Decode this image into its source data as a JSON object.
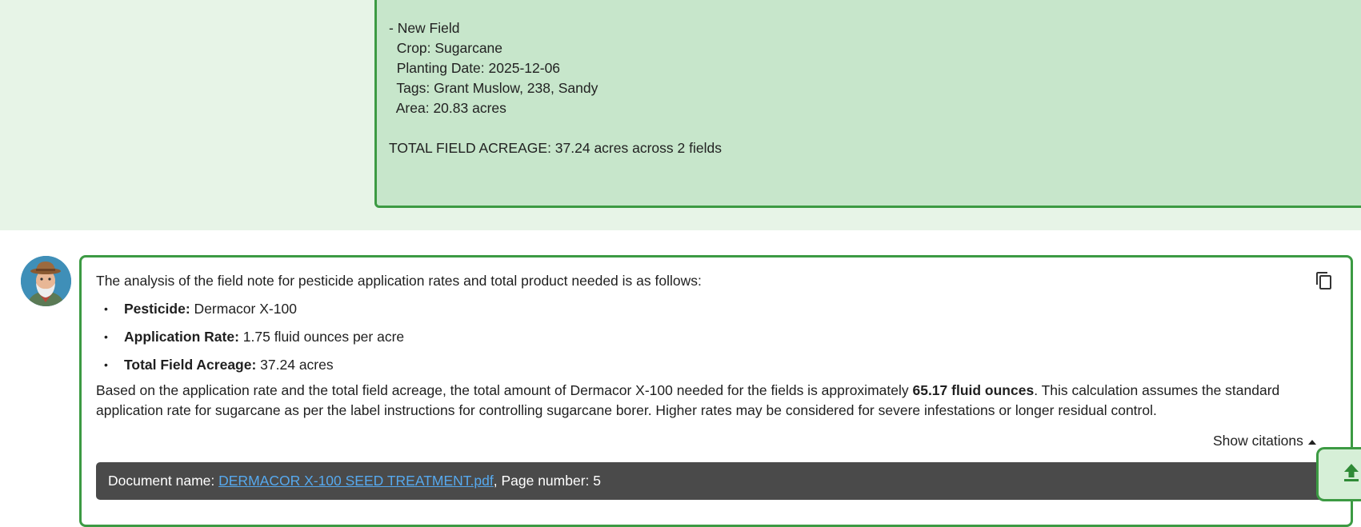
{
  "user_message": {
    "lines": [
      "- New Field",
      "  Crop: Sugarcane",
      "  Planting Date: 2025-12-06",
      "  Tags: Grant Muslow, 238, Sandy",
      "  Area: 20.83 acres",
      "",
      "TOTAL FIELD ACREAGE: 37.24 acres across 2 fields"
    ]
  },
  "assistant_message": {
    "intro": "The analysis of the field note for pesticide application rates and total product needed is as follows:",
    "bullets": [
      {
        "label": "Pesticide:",
        "value": " Dermacor X-100"
      },
      {
        "label": "Application Rate:",
        "value": " 1.75 fluid ounces per acre"
      },
      {
        "label": "Total Field Acreage:",
        "value": " 37.24 acres"
      }
    ],
    "para_before": "Based on the application rate and the total field acreage, the total amount of Dermacor X-100 needed for the fields is approximately ",
    "para_bold": "65.17 fluid ounces",
    "para_after": ". This calculation assumes the standard application rate for sugarcane as per the label instructions for controlling sugarcane borer. Higher rates may be considered for severe infestations or longer residual control.",
    "show_citations_label": "Show citations",
    "citation": {
      "prefix": "Document name: ",
      "doc_name": "DERMACOR X-100 SEED TREATMENT.pdf",
      "suffix": ", Page number: 5"
    }
  },
  "icons": {
    "copy": "copy-icon",
    "upload": "upload-icon",
    "avatar": "farmer-avatar",
    "caret": "caret-up-icon"
  },
  "colors": {
    "user_band": "#e7f4e7",
    "user_bubble": "#c7e6cb",
    "border_green": "#3c9a43",
    "citation_bar": "#4a4a4a",
    "link": "#56a9ee"
  }
}
